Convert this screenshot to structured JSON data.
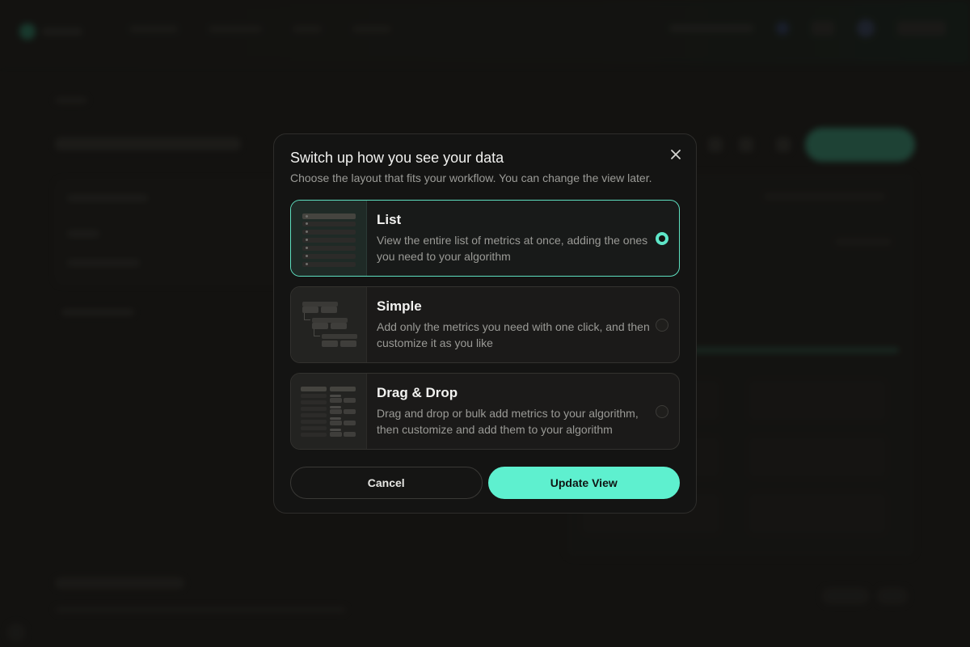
{
  "modal": {
    "title": "Switch up how you see your data",
    "subtitle": "Choose the layout that fits your workflow. You can change the view later.",
    "close_icon": "close-icon",
    "options": [
      {
        "label": "List",
        "description": "View the entire list of metrics at once, adding the ones you need to your algorithm",
        "selected": true
      },
      {
        "label": "Simple",
        "description": "Add only the metrics you need with one click, and then customize it as you like",
        "selected": false
      },
      {
        "label": "Drag & Drop",
        "description": "Drag and drop or bulk add metrics to your algorithm, then customize and add them to your algorithm",
        "selected": false
      }
    ],
    "cancel_label": "Cancel",
    "primary_label": "Update View"
  },
  "colors": {
    "accent": "#5ef0cf",
    "modal_bg": "#141413",
    "page_bg": "#1a1816"
  }
}
